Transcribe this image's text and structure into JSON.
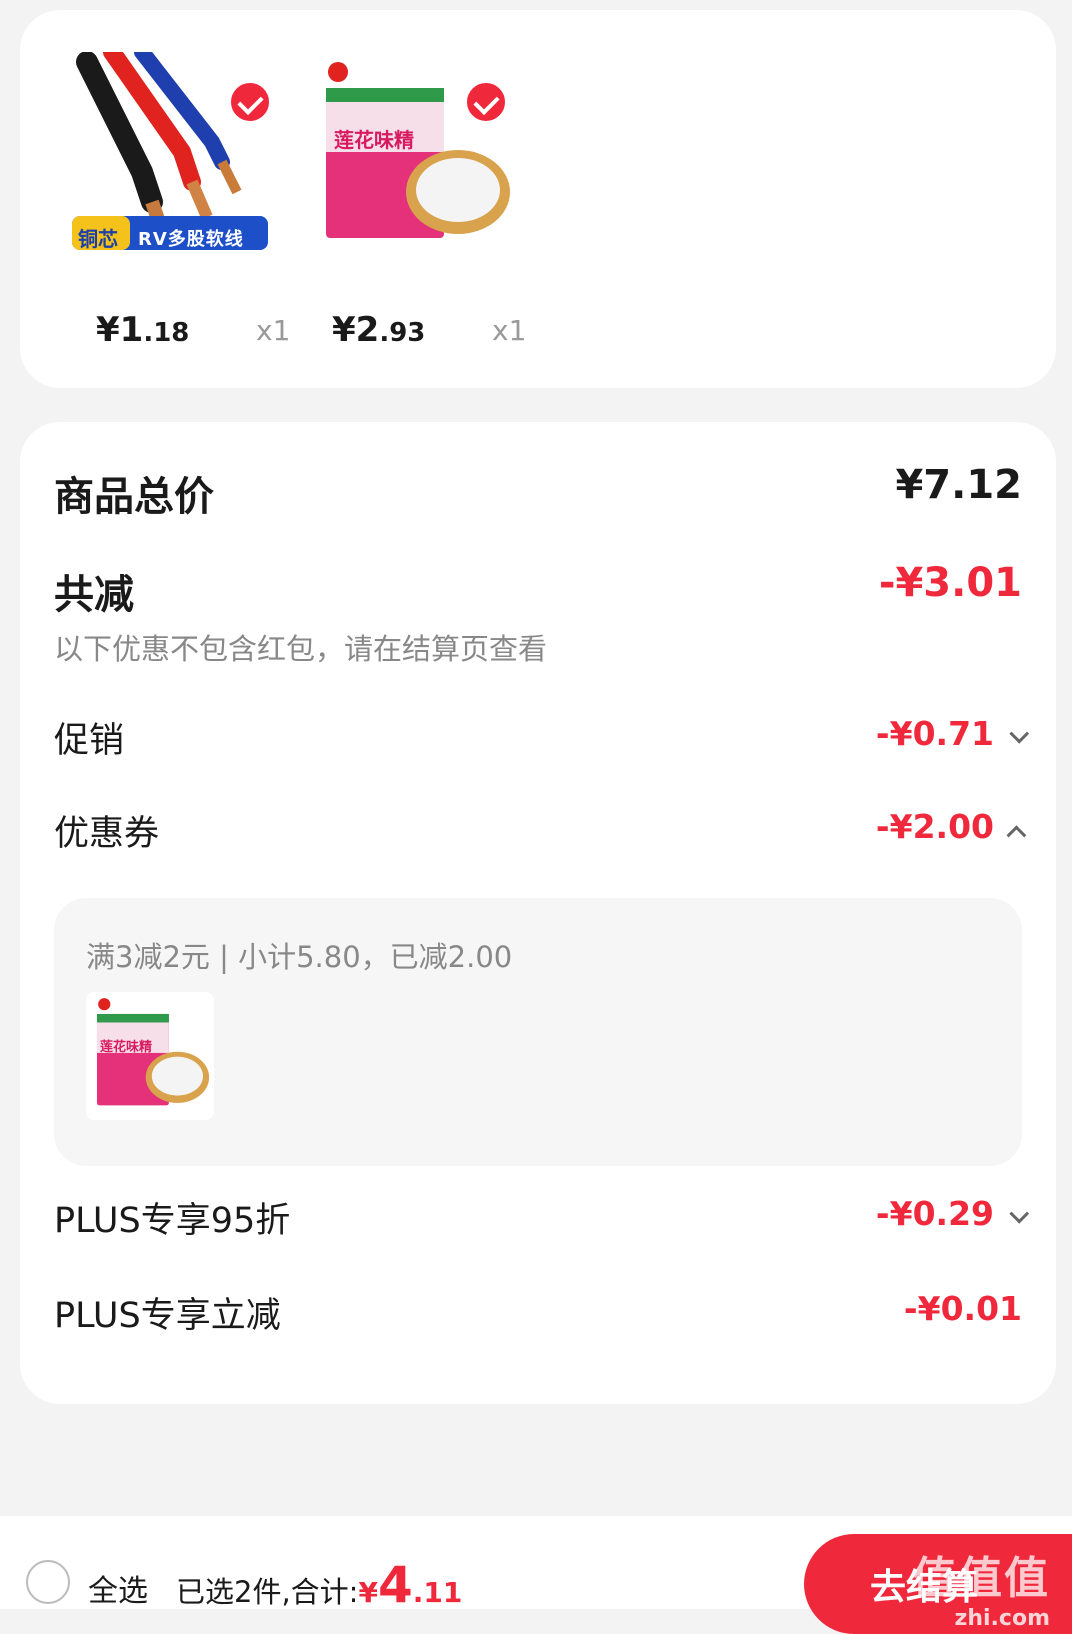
{
  "products": [
    {
      "name": "铜芯RV多股软线",
      "image_text": "铜芯",
      "image_text2": "RV多股软线",
      "price_int": "¥1",
      "price_dec": ".18",
      "qty": "x1",
      "selected": true
    },
    {
      "name": "莲花味精",
      "image_text": "莲花味精",
      "price_int": "¥2",
      "price_dec": ".93",
      "qty": "x1",
      "selected": true
    }
  ],
  "summary": {
    "total_label": "商品总价",
    "total_value": "¥7.12",
    "discount_label": "共减",
    "discount_value": "-¥3.01",
    "discount_note": "以下优惠不包含红包，请在结算页查看",
    "promo_label": "促销",
    "promo_value": "-¥0.71",
    "coupon_label": "优惠券",
    "coupon_value": "-¥2.00",
    "coupon_detail": "满3减2元 | 小计5.80，已减2.00",
    "plus95_label": "PLUS专享95折",
    "plus95_value": "-¥0.29",
    "plusinstant_label": "PLUS专享立减",
    "plusinstant_value": "-¥0.01"
  },
  "bottom": {
    "select_all": "全选",
    "selected_text": "已选2件,合计:",
    "total_currency": "¥",
    "total_int": "4",
    "total_dec": ".11",
    "checkout_label": "去结算",
    "watermark": "值值值",
    "watermark_url": "zhi.com"
  },
  "colors": {
    "accent": "#f0283c",
    "background": "#f3f3f3"
  }
}
